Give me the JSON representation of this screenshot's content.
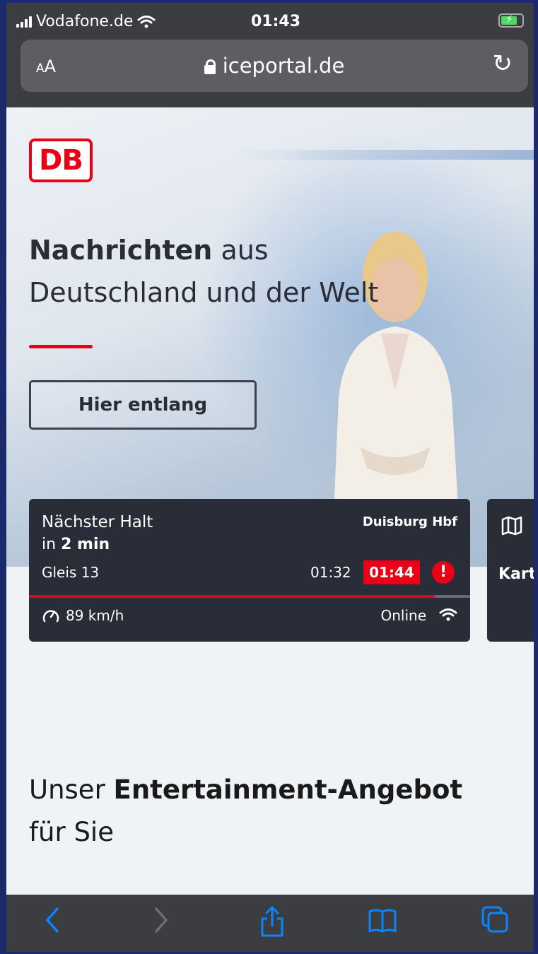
{
  "status_bar": {
    "carrier": "Vodafone.de",
    "time": "01:43"
  },
  "browser": {
    "text_size_label": "AA",
    "url": "iceportal.de",
    "reload_icon": "reload-icon"
  },
  "hero": {
    "logo_text": "DB",
    "headline_bold": "Nachrichten",
    "headline_rest": " aus",
    "headline_line2": "Deutschland und der Welt",
    "cta_label": "Hier entlang"
  },
  "journey": {
    "next_stop_label": "Nächster Halt",
    "station": "Duisburg Hbf",
    "eta_prefix": "in ",
    "eta_value": "2 min",
    "platform": "Gleis 13",
    "scheduled_time": "01:32",
    "actual_time": "01:44",
    "progress": 0.92,
    "speed": "89 km/h",
    "connection_status": "Online"
  },
  "map_card": {
    "label": "Kart"
  },
  "section": {
    "title_prefix": "Unser ",
    "title_bold": "Entertainment-Angebot",
    "title_line2": "für Sie"
  },
  "colors": {
    "db_red": "#ec0016",
    "card_bg": "#282d37",
    "ios_blue": "#0a84ff"
  },
  "toolbar": {
    "icons": [
      "back-icon",
      "forward-icon",
      "share-icon",
      "bookmarks-icon",
      "tabs-icon"
    ]
  }
}
